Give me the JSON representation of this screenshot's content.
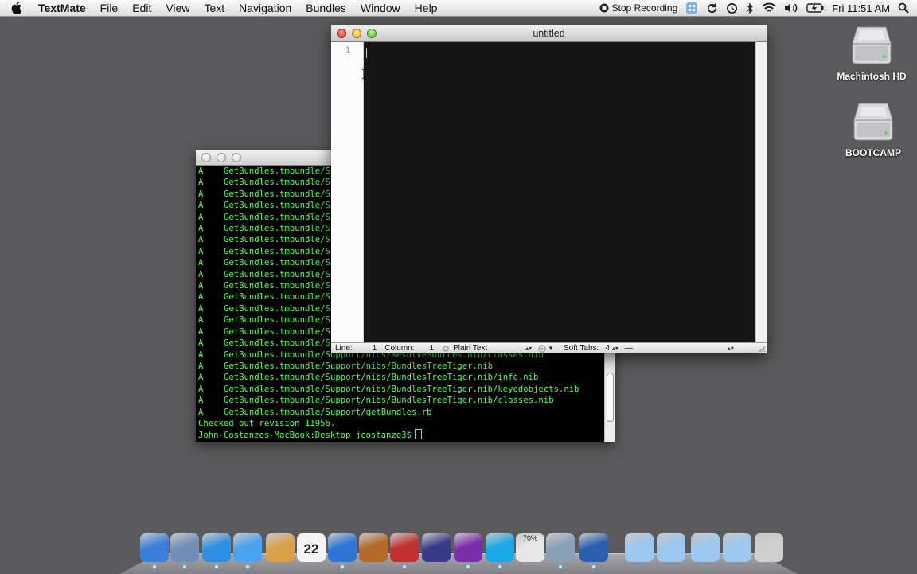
{
  "menubar": {
    "app_name": "TextMate",
    "menus": [
      "File",
      "Edit",
      "View",
      "Text",
      "Navigation",
      "Bundles",
      "Window",
      "Help"
    ],
    "recording_label": "Stop Recording",
    "clock": "Fri 11:51 AM",
    "status_icons": [
      "stop-recording-icon",
      "spaces-icon",
      "sync-icon",
      "time-machine-icon",
      "bluetooth-icon",
      "wifi-icon",
      "volume-icon",
      "battery-icon",
      "spotlight-icon"
    ]
  },
  "desktop": {
    "disks": [
      {
        "label": "Machintosh HD",
        "icon": "hard-drive-icon"
      },
      {
        "label": "BOOTCAMP",
        "icon": "hard-drive-icon"
      }
    ]
  },
  "terminal": {
    "status_prefix": "A",
    "lines": [
      "GetBundles.tmbundle/Sc",
      "GetBundles.tmbundle/Sc",
      "GetBundles.tmbundle/Sc",
      "GetBundles.tmbundle/Sc",
      "GetBundles.tmbundle/Sc",
      "GetBundles.tmbundle/Sc",
      "GetBundles.tmbundle/Sc",
      "GetBundles.tmbundle/Sc",
      "GetBundles.tmbundle/Sc",
      "GetBundles.tmbundle/Sc",
      "GetBundles.tmbundle/Sc",
      "GetBundles.tmbundle/Sc",
      "GetBundles.tmbundle/Sc",
      "GetBundles.tmbundle/Sc",
      "GetBundles.tmbundle/Sc",
      "GetBundles.tmbundle/Sc",
      "GetBundles.tmbundle/Support/nibs/ResolveSources.nib/classes.nib",
      "GetBundles.tmbundle/Support/nibs/BundlesTreeTiger.nib",
      "GetBundles.tmbundle/Support/nibs/BundlesTreeTiger.nib/info.nib",
      "GetBundles.tmbundle/Support/nibs/BundlesTreeTiger.nib/keyedobjects.nib",
      "GetBundles.tmbundle/Support/nibs/BundlesTreeTiger.nib/classes.nib",
      "GetBundles.tmbundle/Support/getBundles.rb"
    ],
    "checkout_message": "Checked out revision 11956.",
    "prompt": "John-Costanzos-MacBook:Desktop jcostanzo3$"
  },
  "textmate": {
    "title": "untitled",
    "line_number": "1",
    "status": {
      "line_label": "Line:",
      "line_value": "1",
      "column_label": "Column:",
      "column_value": "1",
      "language": "Plain Text",
      "tabs_label": "Soft Tabs:",
      "tabs_value": "4",
      "symbol": "—"
    }
  },
  "dock": {
    "apps": [
      {
        "name": "finder-icon",
        "color": "#3b7fd9"
      },
      {
        "name": "preview-icon",
        "color": "#6f8fb8"
      },
      {
        "name": "safari-icon",
        "color": "#2f8fe0"
      },
      {
        "name": "ichat-icon",
        "color": "#4aa3f0"
      },
      {
        "name": "address-book-icon",
        "color": "#d9a14a"
      },
      {
        "name": "ical-icon",
        "color": "#f2f2f2"
      },
      {
        "name": "itunes-icon",
        "color": "#2d76d8"
      },
      {
        "name": "iphoto-icon",
        "color": "#b46a2a"
      },
      {
        "name": "textmate-icon",
        "color": "#c23030"
      },
      {
        "name": "eclipse-icon",
        "color": "#3a3a8a"
      },
      {
        "name": "aperture-icon",
        "color": "#7a2fa8"
      },
      {
        "name": "skype-icon",
        "color": "#19a9e8"
      },
      {
        "name": "activity-monitor-icon",
        "color": "#e8e8e8"
      },
      {
        "name": "system-prefs-icon",
        "color": "#8aa0b8"
      },
      {
        "name": "quicktime-icon",
        "color": "#2a5fb0"
      },
      {
        "name": "applications-folder-icon",
        "color": "#9cc7ee"
      },
      {
        "name": "documents-folder-icon",
        "color": "#9cc7ee"
      },
      {
        "name": "downloads-folder-icon",
        "color": "#9cc7ee"
      },
      {
        "name": "stack-folder-icon",
        "color": "#9cc7ee"
      },
      {
        "name": "trash-icon",
        "color": "#cfcfcf"
      }
    ],
    "ical_day": "22",
    "activity_percent": "70%"
  }
}
